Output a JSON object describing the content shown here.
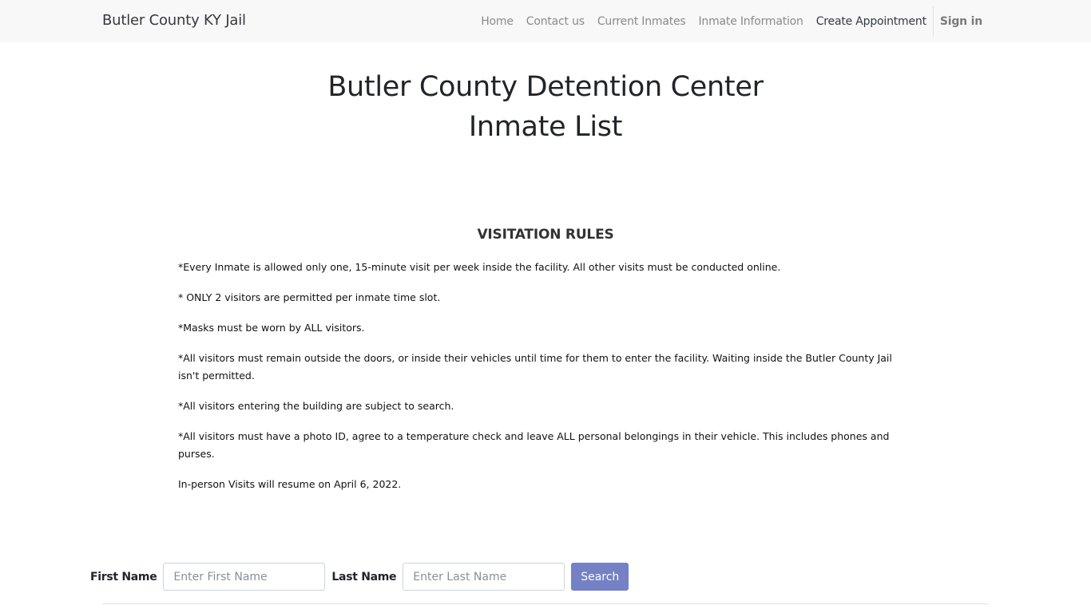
{
  "navbar": {
    "brand": "Butler County KY Jail",
    "links": [
      {
        "label": "Home"
      },
      {
        "label": "Contact us"
      },
      {
        "label": "Current Inmates"
      },
      {
        "label": "Inmate Information"
      },
      {
        "label": "Create Appointment"
      }
    ],
    "sign_in": "Sign in"
  },
  "page": {
    "title_line1": "Butler County Detention Center",
    "title_line2": "Inmate List"
  },
  "rules": {
    "heading": "VISITATION RULES",
    "items": [
      "*Every Inmate is allowed only one, 15-minute visit per week inside the facility. All other visits must be conducted online.",
      "* ONLY 2 visitors are permitted per inmate time slot.",
      "*Masks must be worn by ALL visitors.",
      "*All visitors must remain outside the doors, or inside their vehicles until time for them to enter the facility. Waiting inside the Butler County Jail isn't permitted.",
      "*All visitors entering the building are subject to search.",
      "*All visitors must have a photo ID, agree to a temperature check and leave ALL personal belongings in their vehicle. This includes phones and purses.",
      "In-person Visits will resume on April 6, 2022."
    ]
  },
  "search": {
    "first_name_label": "First Name",
    "first_name_placeholder": "Enter First Name",
    "first_name_value": "",
    "last_name_label": "Last Name",
    "last_name_placeholder": "Enter Last Name",
    "last_name_value": "",
    "button_label": "Search"
  },
  "colors": {
    "navbar_bg": "#f8f8f8",
    "button_accent": "#7481c4"
  }
}
